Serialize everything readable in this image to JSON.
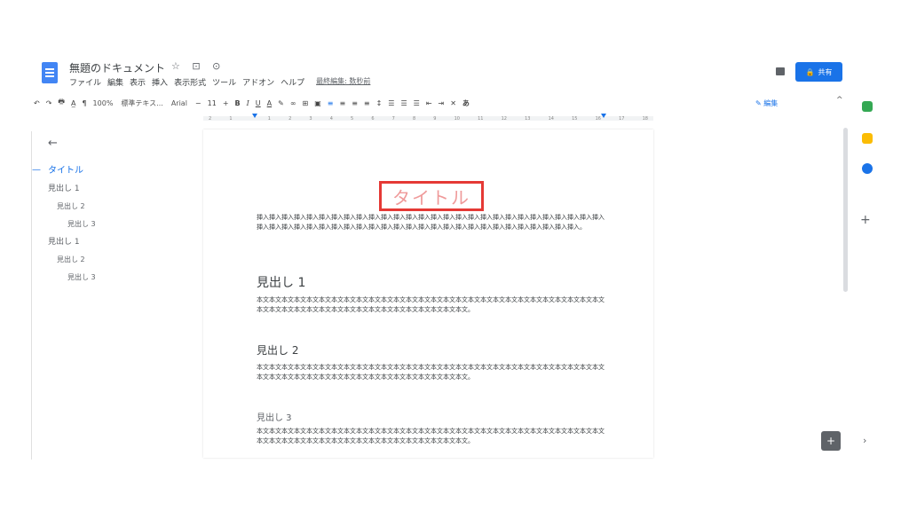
{
  "header": {
    "doc_title": "無題のドキュメント",
    "title_icons": "☆ ⊡ ⊙",
    "menu": [
      "ファイル",
      "編集",
      "表示",
      "挿入",
      "表示形式",
      "ツール",
      "アドオン",
      "ヘルプ"
    ],
    "last_edit": "最終編集: 数秒前",
    "share_label": "共有",
    "share_icon": "🔒"
  },
  "toolbar": {
    "undo": "↶",
    "redo": "↷",
    "print": "🖶",
    "spell": "A̲",
    "paint": "¶",
    "zoom": "100%",
    "style": "標準テキス...",
    "font": "Arial",
    "minus": "−",
    "size": "11",
    "plus": "+",
    "bold": "B",
    "italic": "I",
    "underline": "U",
    "text_color": "A",
    "highlight": "✎",
    "link": "∞",
    "comment": "⊞",
    "image": "▣",
    "align_left": "≡",
    "align_center": "≡",
    "align_right": "≡",
    "justify": "≡",
    "line_spacing": "↕",
    "checklist": "☰",
    "bullets": "☰",
    "numbered": "☰",
    "indent_less": "⇤",
    "indent_more": "⇥",
    "clear": "✕",
    "input": "あ",
    "mode": "✎ 編集",
    "collapse": "^"
  },
  "ruler": {
    "ticks": [
      "2",
      "1",
      "",
      "1",
      "2",
      "3",
      "4",
      "5",
      "6",
      "7",
      "8",
      "9",
      "10",
      "11",
      "12",
      "13",
      "14",
      "15",
      "16",
      "17",
      "18"
    ]
  },
  "outline": {
    "back_icon": "←",
    "dash": "—",
    "items": [
      {
        "label": "タイトル"
      },
      {
        "label": "見出し 1"
      },
      {
        "label": "見出し 2"
      },
      {
        "label": "見出し 3"
      },
      {
        "label": "見出し 1"
      },
      {
        "label": "見出し 2"
      },
      {
        "label": "見出し 3"
      }
    ]
  },
  "page": {
    "title": "タイトル",
    "intro": "挿入挿入挿入挿入挿入挿入挿入挿入挿入挿入挿入挿入挿入挿入挿入挿入挿入挿入挿入挿入挿入挿入挿入挿入挿入挿入挿入挿入挿入挿入挿入挿入挿入挿入挿入挿入挿入挿入挿入挿入挿入挿入挿入挿入挿入挿入挿入挿入挿入挿入挿入挿入挿入挿入。",
    "h1": "見出し 1",
    "p1": "本文本文本文本文本文本文本文本文本文本文本文本文本文本文本文本文本文本文本文本文本文本文本文本文本文本文本文本文本文本文本文本文本文本文本文本文本文本文本文本文本文本文本文本文本文。",
    "h2": "見出し 2",
    "p2": "本文本文本文本文本文本文本文本文本文本文本文本文本文本文本文本文本文本文本文本文本文本文本文本文本文本文本文本文本文本文本文本文本文本文本文本文本文本文本文本文本文本文本文本文本文。",
    "h3": "見出し 3",
    "p3": "本文本文本文本文本文本文本文本文本文本文本文本文本文本文本文本文本文本文本文本文本文本文本文本文本文本文本文本文本文本文本文本文本文本文本文本文本文本文本文本文本文本文本文本文本文。"
  },
  "side_panel": {
    "add": "+",
    "expand": "›",
    "explore": "+"
  },
  "colors": {
    "accent": "#1a73e8",
    "title_box": "#e53935",
    "title_text": "#ef9a9a"
  }
}
